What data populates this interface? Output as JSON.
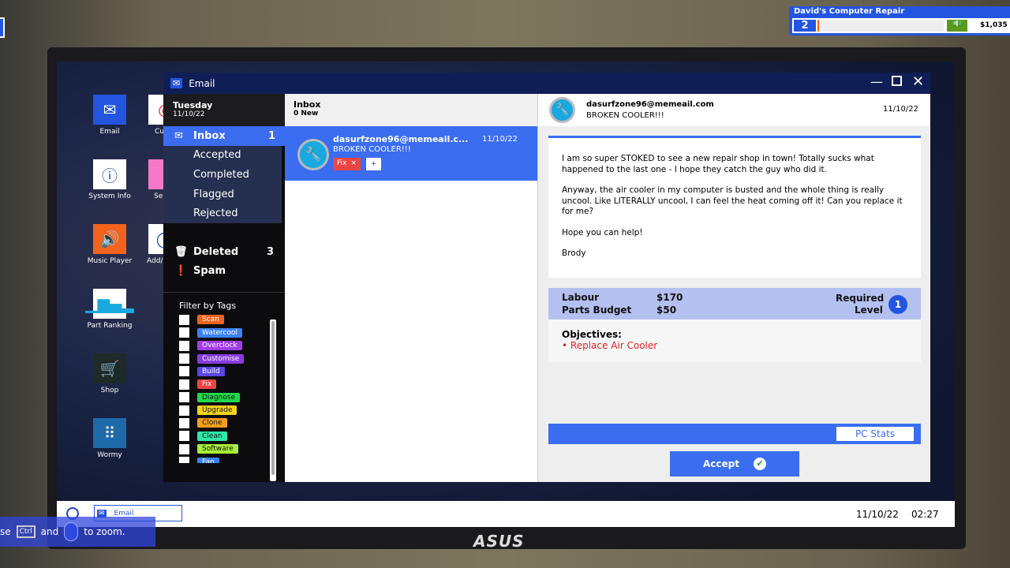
{
  "hud": {
    "company": "David's Computer Repair",
    "level": "2",
    "level_progress": 0.01,
    "money": "$1,035"
  },
  "desktop": {
    "icons": [
      {
        "label": "Email",
        "icon": "envelope-icon"
      },
      {
        "label": "Custo",
        "icon": "target-icon"
      },
      {
        "label": "System Info",
        "icon": "info-icon"
      },
      {
        "label": "Select",
        "icon": "pink-icon"
      },
      {
        "label": "Music Player",
        "icon": "speaker-icon"
      },
      {
        "label": "Add/I Prog",
        "icon": "add-remove-icon"
      },
      {
        "label": "Part Ranking",
        "icon": "bar-chart-icon"
      },
      {
        "label": "Shop",
        "icon": "cart-icon"
      },
      {
        "label": "Wormy",
        "icon": "snake-icon"
      }
    ]
  },
  "window": {
    "title": "Email"
  },
  "nav": {
    "day": "Tuesday",
    "date": "11/10/22",
    "items": [
      {
        "label": "Inbox",
        "count": "1"
      },
      {
        "label": "Accepted"
      },
      {
        "label": "Completed"
      },
      {
        "label": "Flagged"
      },
      {
        "label": "Rejected"
      }
    ],
    "deleted": {
      "label": "Deleted",
      "count": "3"
    },
    "spam": {
      "label": "Spam"
    },
    "filter_title": "Filter by Tags",
    "tags": [
      {
        "label": "Scan",
        "color": "#f4631e"
      },
      {
        "label": "Watercool",
        "color": "#3b82f6"
      },
      {
        "label": "Overclock",
        "color": "#a23be8"
      },
      {
        "label": "Customise",
        "color": "#8a3be0"
      },
      {
        "label": "Build",
        "color": "#5a46e8"
      },
      {
        "label": "Fix",
        "color": "#ef4444"
      },
      {
        "label": "Diagnose",
        "color": "#22d84a"
      },
      {
        "label": "Upgrade",
        "color": "#f5d31a"
      },
      {
        "label": "Clone",
        "color": "#f59e1a"
      },
      {
        "label": "Clean",
        "color": "#2ee8a8"
      },
      {
        "label": "Software",
        "color": "#a8f03a"
      },
      {
        "label": "Fan",
        "color": "#3b82f6"
      }
    ]
  },
  "list": {
    "title": "Inbox",
    "subtitle": "0 New",
    "emails": [
      {
        "from": "dasurfzone96@memeail.c...",
        "subject": "BROKEN COOLER!!!",
        "date": "11/10/22",
        "tag": "Fix",
        "tag_remove": "×",
        "add": "+"
      }
    ]
  },
  "detail": {
    "from": "dasurfzone96@memeail.com",
    "subject": "BROKEN COOLER!!!",
    "date": "11/10/22",
    "body": [
      "I am so super STOKED to see a new repair shop in town! Totally sucks what happened to the last one - I hope they catch the guy who did it.",
      "Anyway, the air cooler in my computer is busted and the whole thing is really uncool. Like LITERALLY uncool, I can feel the heat coming off it! Can you replace it for me?",
      "Hope you can help!",
      "Brody"
    ],
    "labour_label": "Labour",
    "labour": "$170",
    "parts_label": "Parts Budget",
    "parts": "$50",
    "required_label": "Required",
    "level_label": "Level",
    "required_level": "1",
    "objectives_label": "Objectives:",
    "objectives": [
      "Replace Air Cooler"
    ],
    "pc_stats": "PC Stats",
    "accept": "Accept"
  },
  "taskbar": {
    "app": "Email",
    "date": "11/10/22",
    "time": "02:27"
  },
  "hint": {
    "pre": "se",
    "key": "Ctrl",
    "mid": "and",
    "post": "to zoom."
  },
  "monitor": {
    "brand": "ASUS"
  }
}
